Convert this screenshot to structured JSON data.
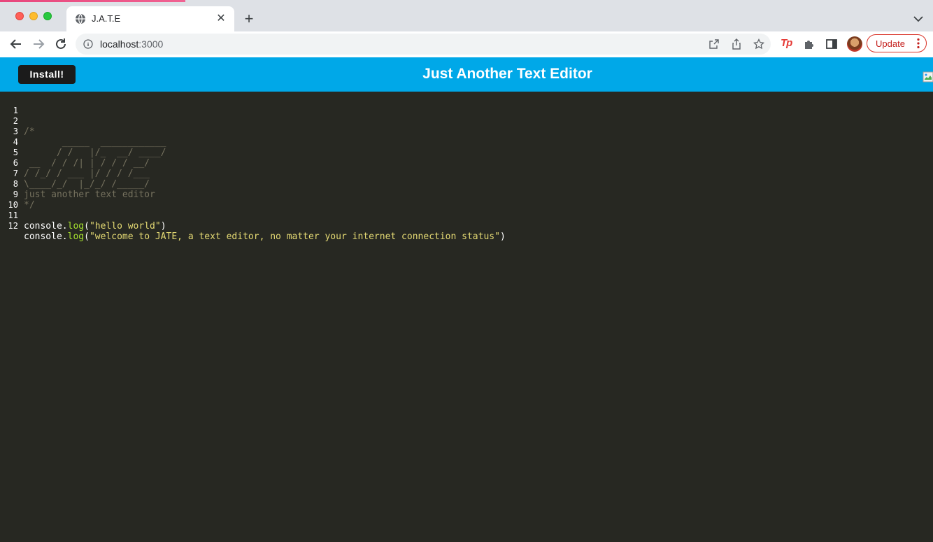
{
  "browser": {
    "tab_title": "J.A.T.E",
    "url_host": "localhost",
    "url_port": ":3000",
    "extension_label": "Tp",
    "update_label": "Update"
  },
  "app": {
    "install_label": "Install!",
    "title": "Just Another Text Editor"
  },
  "editor": {
    "lines": [
      {
        "num": "1",
        "text": ""
      },
      {
        "num": "2",
        "text": "/*"
      },
      {
        "num": "3",
        "text": "       _____  ____________"
      },
      {
        "num": "4",
        "text": "      / /   |/_  __/ ____/"
      },
      {
        "num": "5",
        "text": " __  / / /| | / / / __/"
      },
      {
        "num": "6",
        "text": "/ /_/ / ___ |/ / / /___"
      },
      {
        "num": "7",
        "text": "\\____/_/  |_/_/ /_____/"
      },
      {
        "num": "8",
        "text": "just another text editor"
      },
      {
        "num": "9",
        "text": "*/"
      },
      {
        "num": "10",
        "text": ""
      },
      {
        "num": "11",
        "obj": "console.",
        "fn": "log",
        "open": "(",
        "str": "\"hello world\"",
        "close": ")"
      },
      {
        "num": "12",
        "obj": "console.",
        "fn": "log",
        "open": "(",
        "str": "\"welcome to JATE, a text editor, no matter your internet connection status\"",
        "close": ")"
      }
    ]
  }
}
